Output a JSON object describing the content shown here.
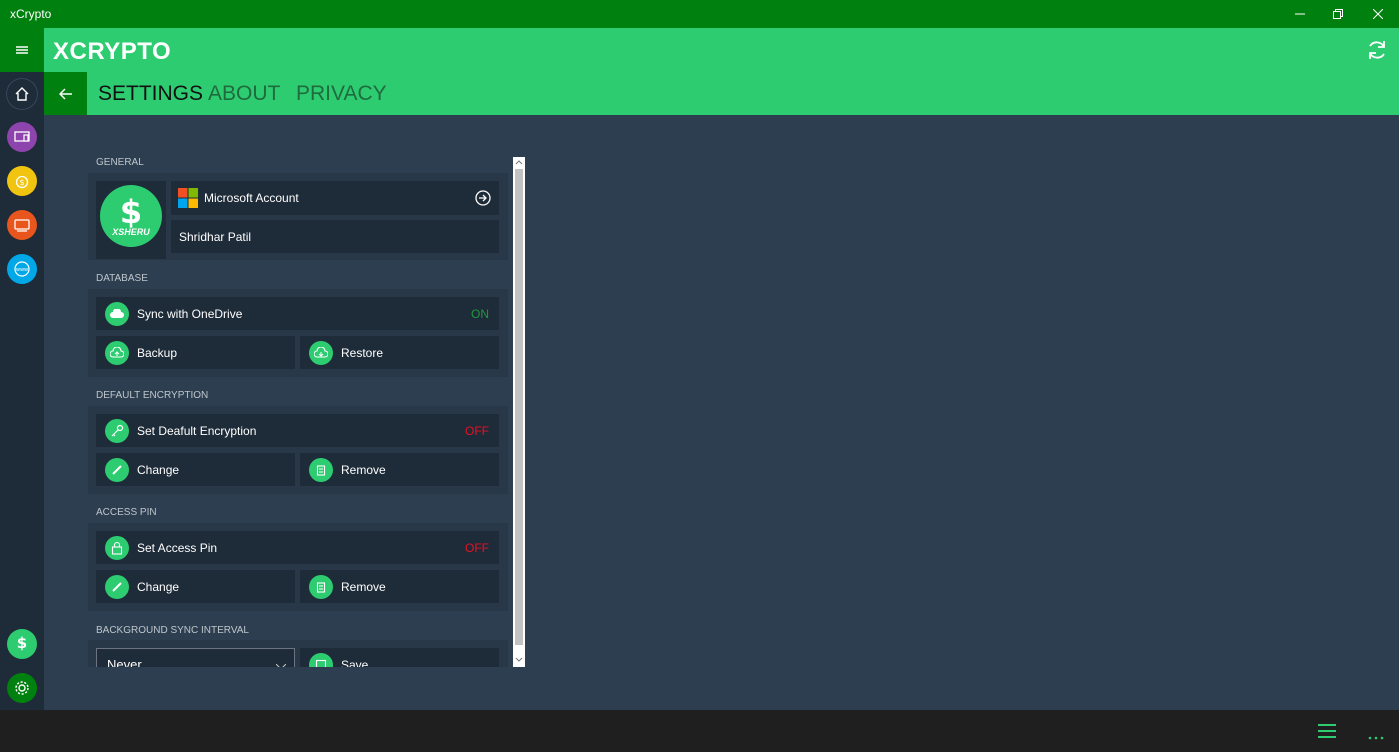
{
  "window": {
    "title": "xCrypto"
  },
  "app": {
    "logo": "XCRYPTO"
  },
  "tabs": [
    {
      "label": "SETTINGS",
      "active": true
    },
    {
      "label": "ABOUT",
      "active": false
    },
    {
      "label": "PRIVACY",
      "active": false
    }
  ],
  "sidebar": {
    "items": [
      {
        "icon": "home-icon",
        "color": "#1e2b38"
      },
      {
        "icon": "devices-icon",
        "color": "#8e44ad"
      },
      {
        "icon": "money-bag-icon",
        "color": "#f1c40f"
      },
      {
        "icon": "screen-icon",
        "color": "#e8561e"
      },
      {
        "icon": "www-globe-icon",
        "color": "#00a8e8"
      }
    ],
    "bottom": [
      {
        "icon": "user-avatar-icon"
      },
      {
        "icon": "settings-gear-icon"
      }
    ]
  },
  "general": {
    "title": "GENERAL",
    "avatar_text": "XSHERU",
    "account_type": "Microsoft Account",
    "user_name": "Shridhar Patil"
  },
  "database": {
    "title": "DATABASE",
    "sync_label": "Sync with OneDrive",
    "sync_status": "ON",
    "backup_label": "Backup",
    "restore_label": "Restore"
  },
  "encryption": {
    "title": "DEFAULT ENCRYPTION",
    "set_label": "Set Deafult Encryption",
    "status": "OFF",
    "change_label": "Change",
    "remove_label": "Remove"
  },
  "pin": {
    "title": "ACCESS PIN",
    "set_label": "Set Access Pin",
    "status": "OFF",
    "change_label": "Change",
    "remove_label": "Remove"
  },
  "sync_interval": {
    "title": "BACKGROUND SYNC INTERVAL",
    "selected": "Never",
    "save_label": "Save"
  },
  "colors": {
    "accent": "#2ecc71",
    "titlebar": "#00800f",
    "on": "#1f9a40",
    "off": "#e81123",
    "background": "#2c3e50"
  }
}
